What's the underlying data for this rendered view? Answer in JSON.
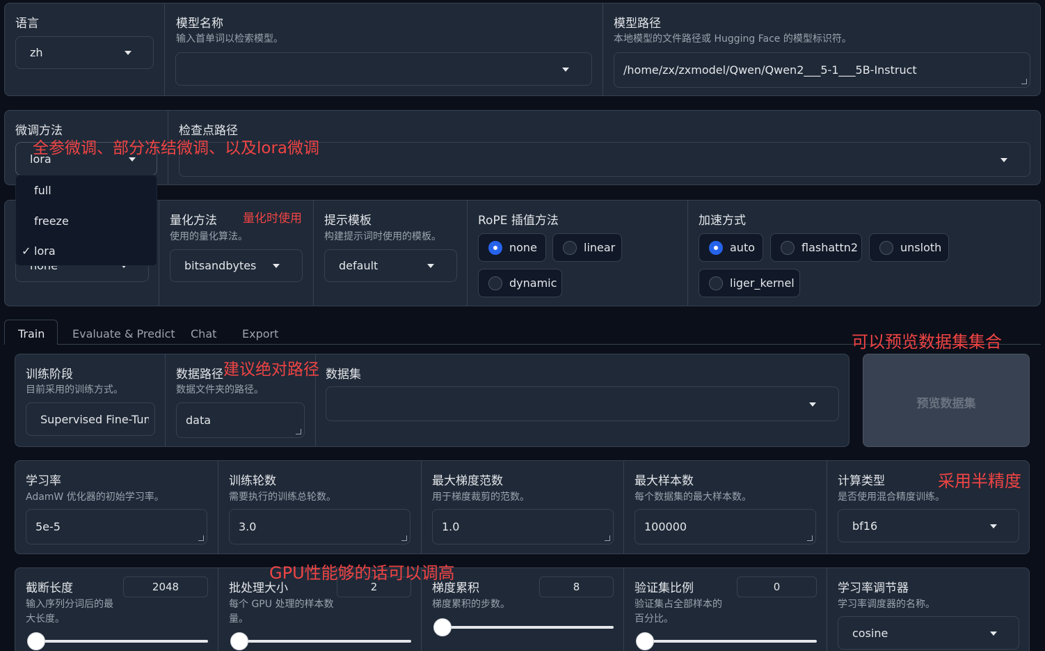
{
  "top": {
    "language": {
      "label": "语言",
      "value": "zh"
    },
    "model_name": {
      "label": "模型名称",
      "info": "输入首单词以检索模型。",
      "value": ""
    },
    "model_path": {
      "label": "模型路径",
      "info": "本地模型的文件路径或 Hugging Face 的模型标识符。",
      "value": "/home/zx/zxmodel/Qwen/Qwen2___5-1___5B-Instruct"
    }
  },
  "finetune": {
    "method_label": "微调方法",
    "method_value": "lora",
    "options": [
      {
        "label": "full",
        "check": ""
      },
      {
        "label": "freeze",
        "check": ""
      },
      {
        "label": "lora",
        "check": "✓"
      }
    ],
    "checkpoint_label": "检查点路径",
    "checkpoint_value": ""
  },
  "advanced": {
    "quant_bit_value": "none",
    "quant_method": {
      "label": "量化方法",
      "info": "使用的量化算法。",
      "value": "bitsandbytes"
    },
    "template": {
      "label": "提示模板",
      "info": "构建提示词时使用的模板。",
      "value": "default"
    },
    "rope": {
      "label": "RoPE 插值方法",
      "options": [
        "none",
        "linear",
        "dynamic"
      ],
      "selected": "none"
    },
    "booster": {
      "label": "加速方式",
      "options": [
        "auto",
        "flashattn2",
        "unsloth",
        "liger_kernel"
      ],
      "selected": "auto"
    }
  },
  "tabs": [
    "Train",
    "Evaluate & Predict",
    "Chat",
    "Export"
  ],
  "train": {
    "stage": {
      "label": "训练阶段",
      "info": "目前采用的训练方式。",
      "value": "Supervised Fine-Tun"
    },
    "dataset_dir": {
      "label": "数据路径",
      "info": "数据文件夹的路径。",
      "value": "data"
    },
    "dataset": {
      "label": "数据集",
      "value": ""
    },
    "preview_button": "预览数据集"
  },
  "hparams": {
    "learning_rate": {
      "label": "学习率",
      "info": "AdamW 优化器的初始学习率。",
      "value": "5e-5"
    },
    "epochs": {
      "label": "训练轮数",
      "info": "需要执行的训练总轮数。",
      "value": "3.0"
    },
    "max_grad_norm": {
      "label": "最大梯度范数",
      "info": "用于梯度裁剪的范数。",
      "value": "1.0"
    },
    "max_samples": {
      "label": "最大样本数",
      "info": "每个数据集的最大样本数。",
      "value": "100000"
    },
    "compute_type": {
      "label": "计算类型",
      "info": "是否使用混合精度训练。",
      "value": "bf16"
    }
  },
  "sliders": {
    "cutoff_len": {
      "label": "截断长度",
      "info1": "输入序列分词后的最",
      "info2": "大长度。",
      "value": "2048",
      "fraction": 0.0
    },
    "batch_size": {
      "label": "批处理大小",
      "info1": "每个 GPU 处理的样本数",
      "info2": "量。",
      "value": "2",
      "fraction": 0.0
    },
    "grad_accum": {
      "label": "梯度累积",
      "info1": "梯度累积的步数。",
      "value": "8",
      "fraction": 0.0
    },
    "val_size": {
      "label": "验证集比例",
      "info1": "验证集占全部样本的",
      "info2": "百分比。",
      "value": "0",
      "fraction": 0.0
    },
    "lr_scheduler": {
      "label": "学习率调节器",
      "info": "学习率调度器的名称。",
      "value": "cosine"
    }
  },
  "annotations": {
    "finetune_note": "全参微调、部分冻结微调、以及lora微调",
    "quant_note": "量化时使用",
    "preview_note": "可以预览数据集集合",
    "path_note": "建议绝对路径",
    "precision_note": "采用半精度",
    "gpu_note": "GPU性能够的话可以调高"
  },
  "colors": {
    "background": "#0b0f19",
    "panel": "#1f2937",
    "accent": "#2563eb",
    "annotation": "#ef4444"
  }
}
